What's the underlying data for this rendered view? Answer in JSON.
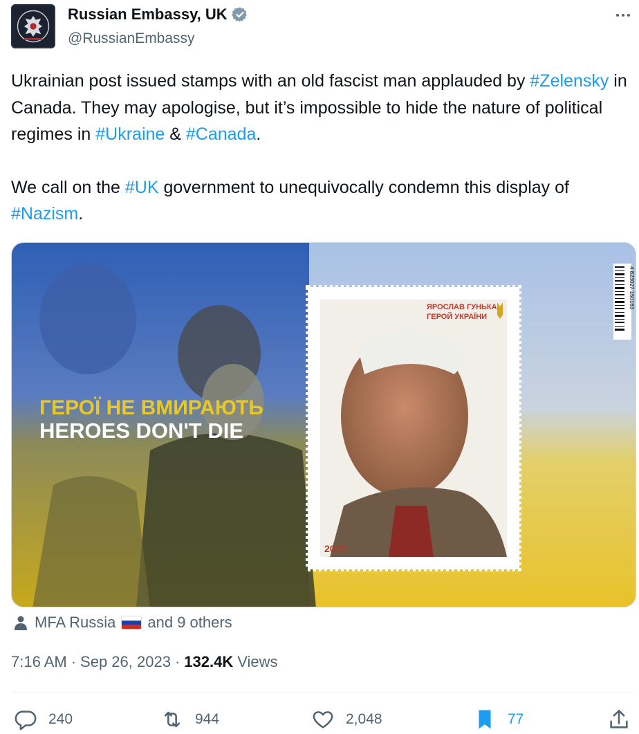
{
  "tweet": {
    "author": {
      "display_name": "Russian Embassy, UK",
      "handle": "@RussianEmbassy",
      "verified": true
    },
    "text": {
      "p1_a": "Ukrainian post issued stamps with an old fascist man applauded by ",
      "p1_tag1": "#Zelensky",
      "p1_b": " in Canada. They may apologise, but it’s impossible to hide the nature of political regimes in ",
      "p1_tag2": "#Ukraine",
      "p1_c": " & ",
      "p1_tag3": "#Canada",
      "p1_d": ".",
      "p2_a": "We call on the ",
      "p2_tag1": "#UK",
      "p2_b": " government to unequivocally condemn this display of ",
      "p2_tag2": "#Nazism",
      "p2_c": "."
    },
    "media": {
      "headline_ua": "ГЕРОЇ НЕ ВМИРАЮТЬ",
      "headline_en": "HEROES DON'T DIE",
      "stamp_name_line1": "ЯРОСЛАВ ГУНЬКА",
      "stamp_name_line2": "ГЕРОЙ УКРАЇНИ",
      "stamp_year": "2023",
      "barcode_text": "4 823027 150163"
    },
    "tagged": {
      "first": "MFA Russia",
      "rest": "and 9 others"
    },
    "meta": {
      "time": "7:16 AM",
      "sep1": "·",
      "date": "Sep 26, 2023",
      "sep2": "·",
      "views_count": "132.4K",
      "views_label": "Views"
    },
    "actions": {
      "replies": "240",
      "retweets": "944",
      "likes": "2,048",
      "bookmarks": "77"
    }
  },
  "colors": {
    "link": "#1d9bf0",
    "secondary_text": "#536471",
    "primary_text": "#0f1419",
    "flag_white": "#ffffff",
    "flag_blue": "#1c3fa8",
    "flag_red": "#d52b1e"
  },
  "icons": [
    "more-icon",
    "verified-icon",
    "person-icon",
    "reply-icon",
    "retweet-icon",
    "like-icon",
    "bookmark-icon",
    "share-icon"
  ]
}
